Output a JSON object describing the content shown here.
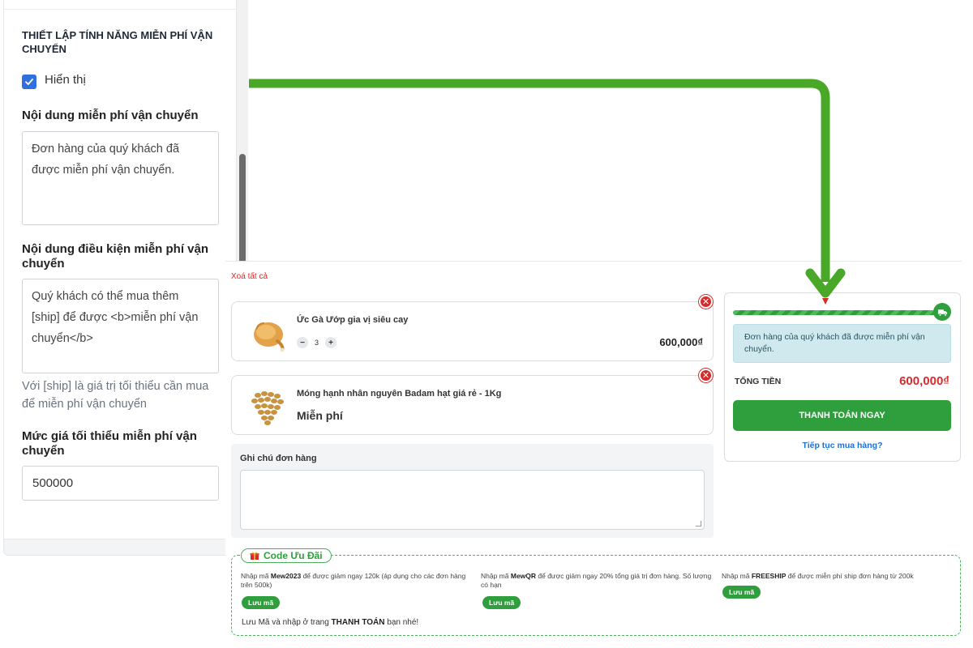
{
  "settings": {
    "section_title": "THIẾT LẬP TÍNH NĂNG MIỄN PHÍ VẬN CHUYỂN",
    "show_label": "Hiển thị",
    "show_checked": true,
    "free_content_label": "Nội dung miễn phí vận chuyển",
    "free_content_value": "Đơn hàng của quý khách đã được miễn phí vận chuyển.",
    "condition_label": "Nội dung điều kiện miễn phí vận chuyển",
    "condition_value": "Quý khách có thể mua thêm [ship] để được <b>miễn phí vận chuyển</b>",
    "condition_hint": "Với [ship] là giá trị tối thiểu cần mua để miễn phí vận chuyển",
    "min_price_label": "Mức giá tối thiểu miễn phí vận chuyển",
    "min_price_value": "500000"
  },
  "cart": {
    "clear_all": "Xoá tất cả",
    "items": [
      {
        "name": "Ức Gà Ướp gia vị siêu cay",
        "qty": "3",
        "qty_minus": "−",
        "qty_plus": "+",
        "price": "600,000₫",
        "remove": "✕"
      },
      {
        "name": "Móng hạnh nhân nguyên Badam hạt giá rẻ - 1Kg",
        "price_text": "Miễn phí",
        "remove": "✕"
      }
    ],
    "note_label": "Ghi chú đơn hàng"
  },
  "summary": {
    "shipping_progress": 1.0,
    "free_message": "Đơn hàng của quý khách đã được miễn phí vận chuyển.",
    "total_label": "TỔNG TIỀN",
    "total_value": "600,000₫",
    "checkout_label": "THANH TOÁN NGAY",
    "continue_label": "Tiếp tục mua hàng?"
  },
  "coupons": {
    "title": "Code Ưu Đãi",
    "items": [
      {
        "prefix": "Nhập mã ",
        "code": "Mew2023",
        "suffix": " để được giảm ngay 120k (áp dụng cho các đơn hàng trên 500k)",
        "save": "Lưu mã"
      },
      {
        "prefix": "Nhập mã ",
        "code": "MewQR",
        "suffix": " để được giảm ngay 20% tổng giá trị đơn hàng. Số lượng có hạn",
        "save": "Lưu mã"
      },
      {
        "prefix": "Nhập mã ",
        "code": "FREESHIP",
        "suffix": " để được miễn phí ship đơn hàng từ 200k",
        "save": "Lưu mã"
      }
    ],
    "footer_prefix": "Lưu Mã và nhập ở trang ",
    "footer_bold": "THANH TOÁN",
    "footer_suffix": " bạn nhé!"
  },
  "colors": {
    "accent_green": "#2e9f3c",
    "arrow_green": "#4aa829",
    "danger_red": "#d62b2b",
    "link_blue": "#1f6fd1",
    "checkbox_blue": "#2f6fde"
  },
  "icons": [
    "check-icon",
    "close-icon",
    "truck-icon",
    "gift-icon",
    "arrow-icon"
  ]
}
